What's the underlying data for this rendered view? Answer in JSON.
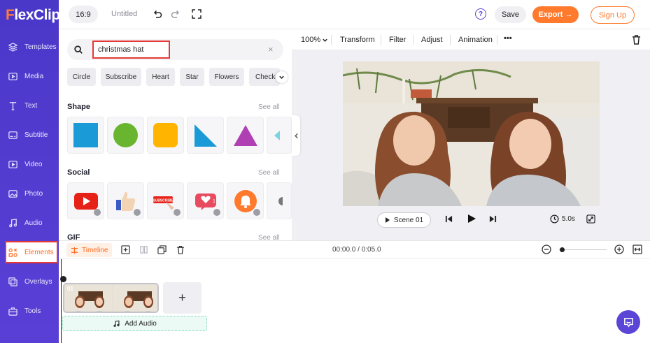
{
  "brand": {
    "logo_letter": "F",
    "logo_rest": "lexClip",
    "accent": "#5b45d6",
    "orange": "#ff7a2c"
  },
  "sidebar": {
    "items": [
      {
        "label": "Templates",
        "icon": "layers-icon"
      },
      {
        "label": "Media",
        "icon": "media-icon"
      },
      {
        "label": "Text",
        "icon": "text-icon"
      },
      {
        "label": "Subtitle",
        "icon": "subtitle-icon"
      },
      {
        "label": "Video",
        "icon": "video-icon"
      },
      {
        "label": "Photo",
        "icon": "photo-icon"
      },
      {
        "label": "Audio",
        "icon": "music-icon"
      },
      {
        "label": "Elements",
        "icon": "elements-icon",
        "active": true
      },
      {
        "label": "Overlays",
        "icon": "overlays-icon"
      },
      {
        "label": "Tools",
        "icon": "toolbox-icon"
      }
    ]
  },
  "header": {
    "ratio": "16:9",
    "title": "Untitled",
    "help": "?",
    "save": "Save",
    "export": "Export →",
    "signup": "Sign Up"
  },
  "panel": {
    "search": {
      "value": "christmas hat"
    },
    "chips": [
      "Circle",
      "Subscribe",
      "Heart",
      "Star",
      "Flowers",
      "Check"
    ],
    "sections": {
      "shape": {
        "title": "Shape",
        "see_all": "See all"
      },
      "social": {
        "title": "Social",
        "see_all": "See all"
      },
      "gif": {
        "title": "GIF",
        "see_all": "See all"
      }
    },
    "social_tiles": {
      "subscribe_text": "SUBSCRIBE",
      "notification_count": "1"
    }
  },
  "canvas": {
    "toolbar": {
      "zoom": "100%",
      "transform": "Transform",
      "filter": "Filter",
      "adjust": "Adjust",
      "animation": "Animation",
      "more": "•••"
    },
    "scene": "Scene 01",
    "duration": "5.0s"
  },
  "timeline": {
    "label": "Timeline",
    "time": "00:00.0 / 0:05.0",
    "clip_number": "01",
    "add": "+",
    "add_audio": "Add Audio"
  }
}
